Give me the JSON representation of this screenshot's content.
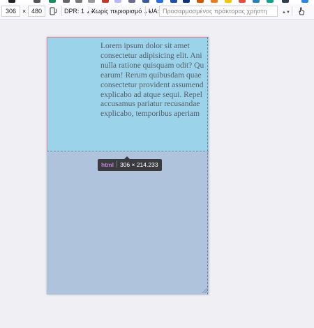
{
  "toolbar": {
    "width_value": "306",
    "times": "×",
    "height_value": "480",
    "rotate_icon": "rotate-icon",
    "dpr_label": "DPR: 1",
    "throttle_label": "Χωρίς περιορισμό",
    "ua_label": "UA:",
    "ua_placeholder": "Προσαρμοσμένος πράκτορας χρήστη",
    "touch_icon": "touch-hand-icon"
  },
  "viewport": {
    "lorem_lines": [
      "Lorem ipsum dolor sit amet",
      "consectetur adipisicing elit. Ani",
      "nulla ratione quisquam odit? Qu",
      "earum! Rerum quibusdam quae",
      "consectetur provident assumend",
      "explicabo ad atque sequi. Repel",
      "accusamus pariatur recusandae",
      "explicabo, temporibus aperiam"
    ]
  },
  "tooltip": {
    "tag": "html",
    "size": "306 × 214.233"
  },
  "colors": {
    "highlight_content": "#9bd3ea",
    "page_background": "#b0c3dd",
    "tooltip_bg": "#3a3b3f",
    "tag_color": "#c77ddb"
  }
}
